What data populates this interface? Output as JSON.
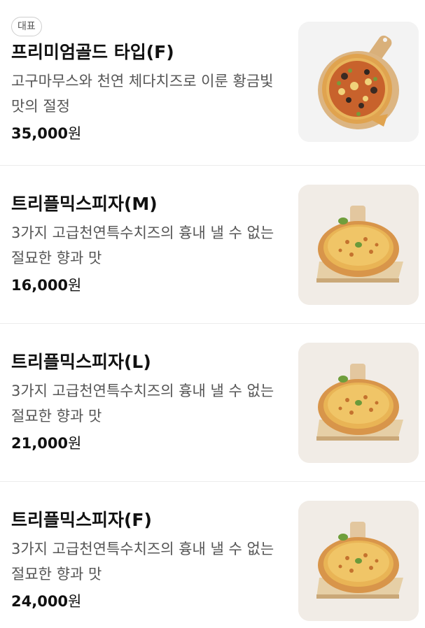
{
  "menu": {
    "items": [
      {
        "badge": "대표",
        "name": "프리미엄골드 타입(F)",
        "desc": "고구마무스와 천연 체다치즈로 이룬 황금빛 맛의 절정",
        "price": "35,000",
        "unit": "원",
        "image": "premium-gold-pizza-image"
      },
      {
        "name": "트리플믹스피자(M)",
        "desc": "3가지 고급천연특수치즈의 흉내 낼 수 없는 절묘한 향과 맛",
        "price": "16,000",
        "unit": "원",
        "image": "triple-mix-pizza-image"
      },
      {
        "name": "트리플믹스피자(L)",
        "desc": "3가지 고급천연특수치즈의 흉내 낼 수 없는 절묘한 향과 맛",
        "price": "21,000",
        "unit": "원",
        "image": "triple-mix-pizza-image"
      },
      {
        "name": "트리플믹스피자(F)",
        "desc": "3가지 고급천연특수치즈의 흉내 낼 수 없는 절묘한 향과 맛",
        "price": "24,000",
        "unit": "원",
        "image": "triple-mix-pizza-image"
      }
    ]
  },
  "colors": {
    "text_primary": "#111111",
    "text_secondary": "#555555",
    "divider": "#ececec",
    "badge_border": "#cfcfcf"
  }
}
